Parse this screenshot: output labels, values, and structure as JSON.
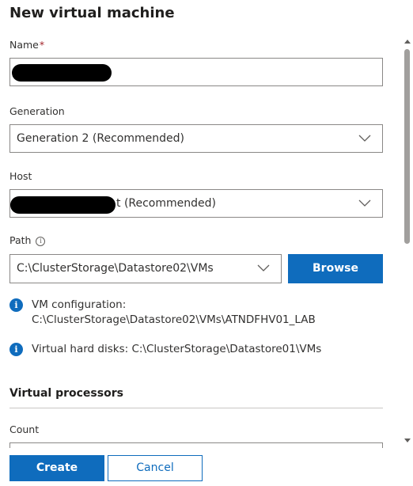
{
  "dialog": {
    "title": "New virtual machine"
  },
  "name_field": {
    "label": "Name",
    "required_marker": "*",
    "value": ""
  },
  "generation": {
    "label": "Generation",
    "selected": "Generation 2 (Recommended)"
  },
  "host": {
    "label": "Host",
    "selected_suffix": "t (Recommended)"
  },
  "path": {
    "label": "Path",
    "info_icon": "info-circle-icon",
    "selected": "C:\\ClusterStorage\\Datastore02\\VMs",
    "browse_label": "Browse"
  },
  "info_messages": [
    {
      "icon": "info-icon",
      "line1": "VM configuration:",
      "line2": "C:\\ClusterStorage\\Datastore02\\VMs\\ATNDFHV01_LAB"
    },
    {
      "icon": "info-icon",
      "line1": "Virtual hard disks: C:\\ClusterStorage\\Datastore01\\VMs"
    }
  ],
  "virtual_processors": {
    "heading": "Virtual processors",
    "count_label": "Count"
  },
  "footer": {
    "create_label": "Create",
    "cancel_label": "Cancel"
  },
  "colors": {
    "accent": "#0f6cbd",
    "required": "#a4262c",
    "border": "#8a8886"
  }
}
